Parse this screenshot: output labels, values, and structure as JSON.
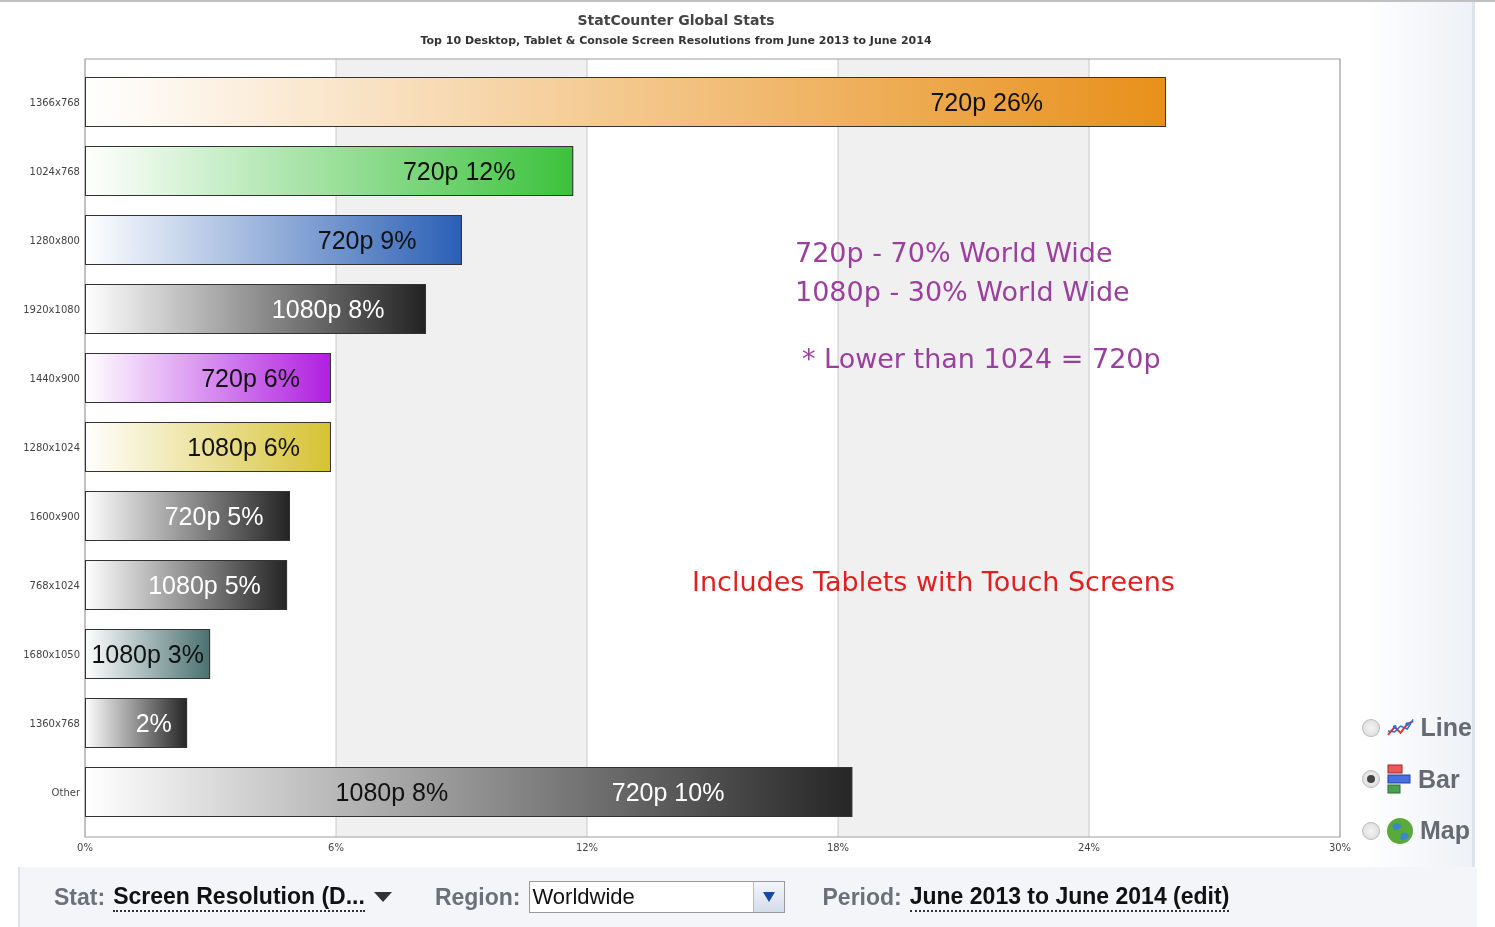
{
  "chart": {
    "title": "StatCounter Global Stats",
    "subtitle": "Top 10 Desktop, Tablet & Console Screen Resolutions from June 2013 to June 2014",
    "chart_data": {
      "type": "bar",
      "orientation": "horizontal",
      "grid": true,
      "categories": [
        "1366x768",
        "1024x768",
        "1280x800",
        "1920x1080",
        "1440x900",
        "1280x1024",
        "1600x900",
        "768x1024",
        "1680x1050",
        "1360x768",
        "Other"
      ],
      "series": [
        {
          "values": [
            25.84,
            11.67,
            9.01,
            8.15,
            5.88,
            5.88,
            4.9,
            4.83,
            2.99,
            2.44,
            18.34
          ]
        }
      ],
      "xlim": [
        0,
        30
      ],
      "xticks": [
        {
          "value": 0,
          "label": "0%"
        },
        {
          "value": 6,
          "label": "6%"
        },
        {
          "value": 12,
          "label": "12%"
        },
        {
          "value": 18,
          "label": "18%"
        },
        {
          "value": 24,
          "label": "24%"
        },
        {
          "value": 30,
          "label": "30%"
        }
      ]
    },
    "bars": [
      {
        "color": "#e8901a",
        "labels": [
          {
            "text": "720p 26%",
            "light_text": false
          }
        ]
      },
      {
        "color": "#3cc23c",
        "labels": [
          {
            "text": "720p 12%",
            "light_text": false
          }
        ]
      },
      {
        "color": "#2a5fb5",
        "labels": [
          {
            "text": "720p 9%",
            "light_text": false
          }
        ]
      },
      {
        "color": "#222222",
        "labels": [
          {
            "text": "1080p 8%",
            "light_text": true
          }
        ]
      },
      {
        "color": "#b01ee0",
        "labels": [
          {
            "text": "720p 6%",
            "light_text": false
          }
        ]
      },
      {
        "color": "#d6c232",
        "labels": [
          {
            "text": "1080p 6%",
            "light_text": false
          }
        ]
      },
      {
        "color": "#232323",
        "labels": [
          {
            "text": "720p 5%",
            "light_text": true
          }
        ]
      },
      {
        "color": "#242424",
        "labels": [
          {
            "text": "1080p 5%",
            "light_text": true
          }
        ]
      },
      {
        "color": "#4a7070",
        "labels": [
          {
            "text": "1080p 3%",
            "light_text": false
          }
        ]
      },
      {
        "color": "#252525",
        "labels": [
          {
            "text": "2%",
            "light_text": true
          }
        ]
      },
      {
        "color": "#262626",
        "labels": [
          {
            "text": "1080p 8%",
            "light_text": false
          },
          {
            "text": "720p 10%",
            "light_text": true
          }
        ]
      }
    ],
    "notes": [
      {
        "text": "720p - 70% World Wide",
        "color": "#9b3f9e"
      },
      {
        "text": "1080p - 30% World Wide",
        "color": "#9b3f9e"
      },
      {
        "text": "* Lower than 1024 = 720p",
        "color": "#9b3f9e"
      },
      {
        "text": "Includes Tablets with Touch Screens",
        "color": "#e02020"
      }
    ]
  },
  "chart_types": [
    {
      "label": "Line",
      "kind": "line",
      "selected": false
    },
    {
      "label": "Bar",
      "kind": "bar",
      "selected": true
    },
    {
      "label": "Map",
      "kind": "map",
      "selected": false
    }
  ],
  "filters": {
    "stat_label": "Stat:",
    "stat_value": "Screen Resolution (D...",
    "region_label": "Region:",
    "region_value": "Worldwide",
    "period_label": "Period:",
    "period_value": "June 2013 to June 2014 (edit)"
  }
}
